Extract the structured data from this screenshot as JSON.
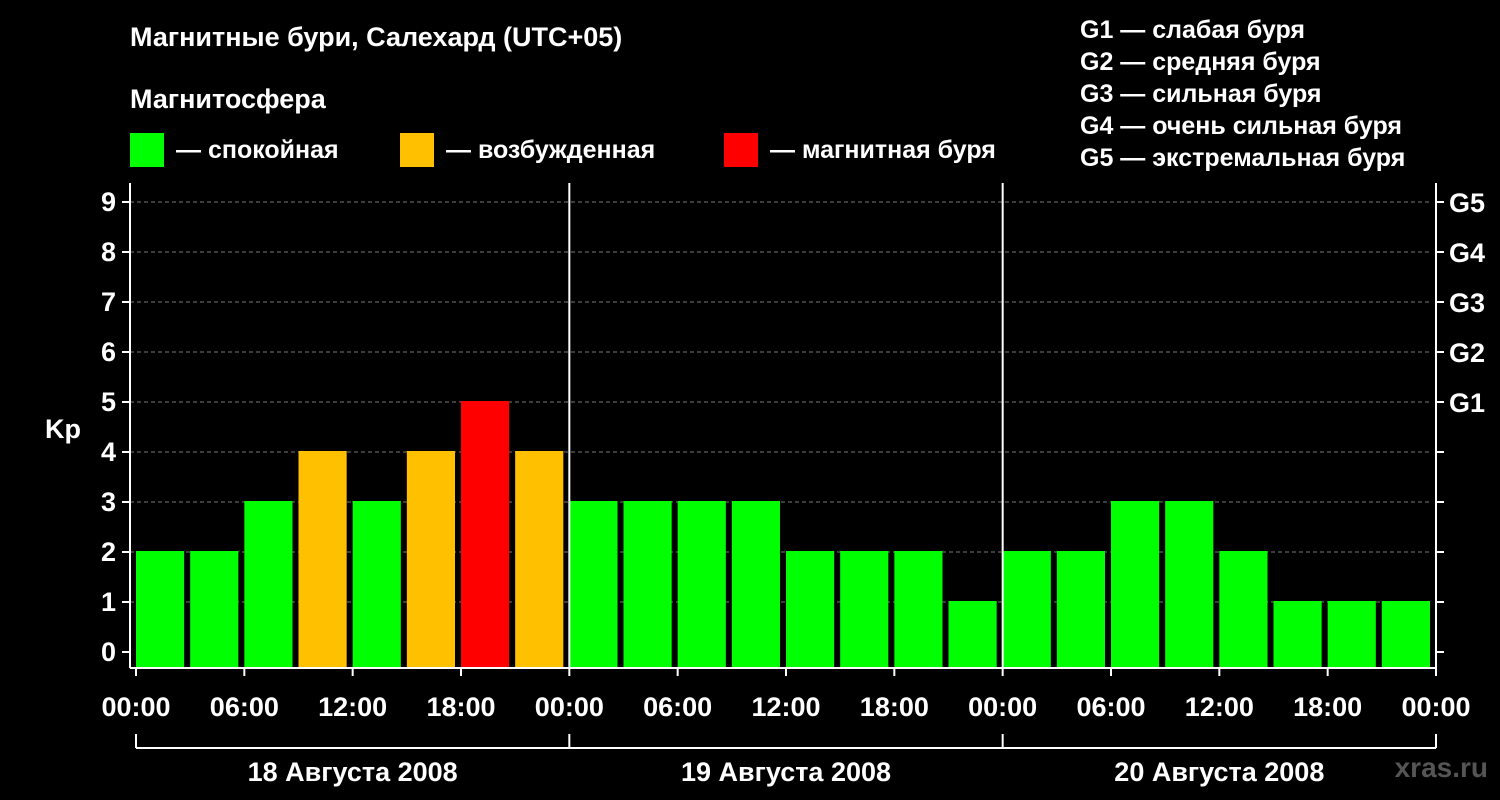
{
  "header": {
    "title": "Магнитные бури, Салехард (UTC+05)",
    "subtitle": "Магнитосфера"
  },
  "legend": [
    {
      "label": "— спокойная",
      "color": "#00ff00"
    },
    {
      "label": "— возбужденная",
      "color": "#ffc000"
    },
    {
      "label": "— магнитная буря",
      "color": "#ff0000"
    }
  ],
  "g_scale": [
    "G1 — слабая буря",
    "G2 — средняя буря",
    "G3 — сильная буря",
    "G4 — очень сильная буря",
    "G5 — экстремальная буря"
  ],
  "watermark": "xras.ru",
  "chart_data": {
    "type": "bar",
    "ylabel": "Kp",
    "ylim": [
      0,
      9
    ],
    "yticks": [
      "0",
      "1",
      "2",
      "3",
      "4",
      "5",
      "6",
      "7",
      "8",
      "9"
    ],
    "right_ticks": [
      {
        "kp": 5,
        "label": "G1"
      },
      {
        "kp": 6,
        "label": "G2"
      },
      {
        "kp": 7,
        "label": "G3"
      },
      {
        "kp": 8,
        "label": "G4"
      },
      {
        "kp": 9,
        "label": "G5"
      }
    ],
    "xtick_labels": [
      "00:00",
      "06:00",
      "12:00",
      "18:00",
      "00:00",
      "06:00",
      "12:00",
      "18:00",
      "00:00",
      "06:00",
      "12:00",
      "18:00",
      "00:00"
    ],
    "days": [
      "18 Августа 2008",
      "19 Августа 2008",
      "20 Августа 2008"
    ],
    "grid": "dashed horizontal at each Kp level",
    "colors": {
      "quiet": "#00ff00",
      "unsettled": "#ffc000",
      "storm": "#ff0000"
    },
    "series": [
      {
        "values": [
          2,
          2,
          3,
          4,
          3,
          4,
          5,
          4,
          3,
          3,
          3,
          3,
          2,
          2,
          2,
          1,
          2,
          2,
          3,
          3,
          2,
          1,
          1,
          1
        ],
        "levels": [
          "quiet",
          "quiet",
          "quiet",
          "unsettled",
          "quiet",
          "unsettled",
          "storm",
          "unsettled",
          "quiet",
          "quiet",
          "quiet",
          "quiet",
          "quiet",
          "quiet",
          "quiet",
          "quiet",
          "quiet",
          "quiet",
          "quiet",
          "quiet",
          "quiet",
          "quiet",
          "quiet",
          "quiet"
        ]
      }
    ]
  }
}
